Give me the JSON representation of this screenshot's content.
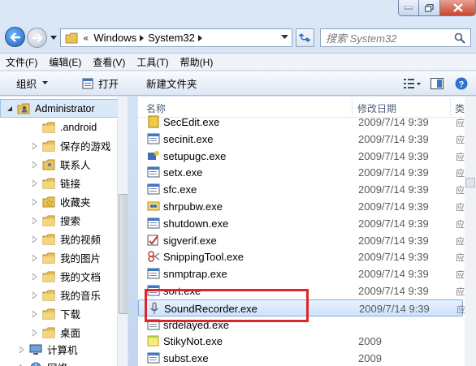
{
  "window": {
    "caption_buttons": [
      "minimize-icon",
      "maximize-icon",
      "close-icon"
    ]
  },
  "address": {
    "overflow": "«",
    "crumbs": [
      "Windows",
      "System32"
    ],
    "search_placeholder": "搜索 System32"
  },
  "menu": [
    "文件(F)",
    "编辑(E)",
    "查看(V)",
    "工具(T)",
    "帮助(H)"
  ],
  "commands": {
    "organize": "组织",
    "open": "打开",
    "new_folder": "新建文件夹"
  },
  "nav": [
    {
      "label": "Administrator",
      "icon": "user-folder-icon",
      "selected": true
    },
    {
      "label": ".android",
      "icon": "folder-icon"
    },
    {
      "label": "保存的游戏",
      "icon": "saved-games-icon"
    },
    {
      "label": "联系人",
      "icon": "contacts-icon"
    },
    {
      "label": "链接",
      "icon": "links-icon"
    },
    {
      "label": "收藏夹",
      "icon": "favorites-icon"
    },
    {
      "label": "搜索",
      "icon": "searches-icon"
    },
    {
      "label": "我的视频",
      "icon": "videos-icon"
    },
    {
      "label": "我的图片",
      "icon": "pictures-icon"
    },
    {
      "label": "我的文档",
      "icon": "documents-icon"
    },
    {
      "label": "我的音乐",
      "icon": "music-icon"
    },
    {
      "label": "下载",
      "icon": "downloads-icon"
    },
    {
      "label": "桌面",
      "icon": "desktop-icon"
    },
    {
      "label": "计算机",
      "icon": "computer-icon"
    },
    {
      "label": "网络",
      "icon": "network-icon"
    }
  ],
  "columns": {
    "name": "名称",
    "modified": "修改日期",
    "type": "类"
  },
  "files": [
    {
      "name": "SecEdit.exe",
      "date": "2009/7/14 9:39",
      "type": "应"
    },
    {
      "name": "secinit.exe",
      "date": "2009/7/14 9:39",
      "type": "应"
    },
    {
      "name": "setupugc.exe",
      "date": "2009/7/14 9:39",
      "type": "应"
    },
    {
      "name": "setx.exe",
      "date": "2009/7/14 9:39",
      "type": "应"
    },
    {
      "name": "sfc.exe",
      "date": "2009/7/14 9:39",
      "type": "应"
    },
    {
      "name": "shrpubw.exe",
      "date": "2009/7/14 9:39",
      "type": "应"
    },
    {
      "name": "shutdown.exe",
      "date": "2009/7/14 9:39",
      "type": "应"
    },
    {
      "name": "sigverif.exe",
      "date": "2009/7/14 9:39",
      "type": "应"
    },
    {
      "name": "SnippingTool.exe",
      "date": "2009/7/14 9:39",
      "type": "应"
    },
    {
      "name": "snmptrap.exe",
      "date": "2009/7/14 9:39",
      "type": "应"
    },
    {
      "name": "sort.exe",
      "date": "2009/7/14 9:39",
      "type": "应"
    },
    {
      "name": "SoundRecorder.exe",
      "date": "2009/7/14 9:39",
      "type": "应",
      "highlighted": true
    },
    {
      "name": "srdelayed.exe",
      "date": "",
      "type": ""
    },
    {
      "name": "StikyNot.exe",
      "date": "2009",
      "type": ""
    },
    {
      "name": "subst.exe",
      "date": "2009",
      "type": ""
    }
  ]
}
